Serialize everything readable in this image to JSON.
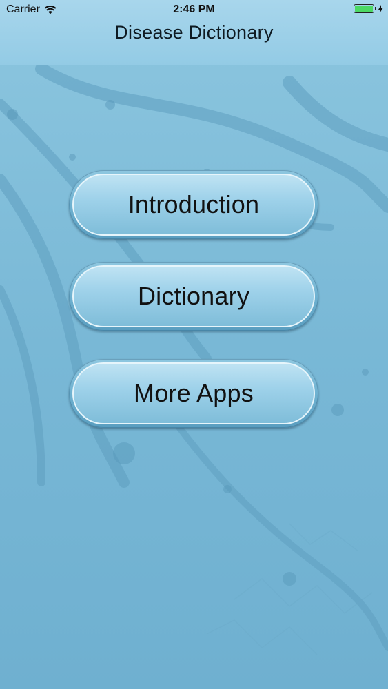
{
  "status_bar": {
    "carrier": "Carrier",
    "time": "2:46 PM",
    "battery_level": 1.0,
    "battery_color": "#4cd964",
    "wifi_icon": "wifi-icon",
    "charging_icon": "bolt-icon"
  },
  "nav": {
    "title": "Disease Dictionary"
  },
  "menu": {
    "buttons": [
      {
        "label": "Introduction"
      },
      {
        "label": "Dictionary"
      },
      {
        "label": "More Apps"
      }
    ]
  },
  "colors": {
    "background": "#7fbcd8",
    "nav_background": "#a8d6ec"
  }
}
